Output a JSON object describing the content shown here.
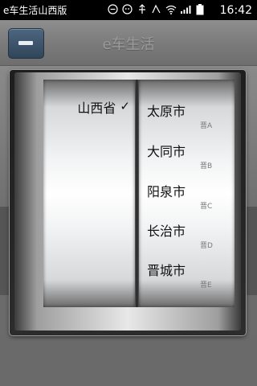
{
  "status_bar": {
    "notification_text": "e车生活山西版",
    "time": "16:42",
    "icons": [
      "usb-icon",
      "android-icon",
      "usb-debug-icon",
      "alarm-icon",
      "wifi-icon",
      "signal-icon",
      "battery-icon"
    ]
  },
  "app_bar": {
    "title": "e车生活"
  },
  "picker": {
    "province": {
      "label": "山西省",
      "check": "✓"
    },
    "cities": [
      {
        "name": "太原市",
        "code": "晋A"
      },
      {
        "name": "大同市",
        "code": "晋B"
      },
      {
        "name": "阳泉市",
        "code": "晋C"
      },
      {
        "name": "长治市",
        "code": "晋D"
      },
      {
        "name": "晋城市",
        "code": "晋E"
      }
    ]
  },
  "colors": {
    "back_button": "#3b556d",
    "dialog_frame": "#262626",
    "text": "#111111"
  }
}
